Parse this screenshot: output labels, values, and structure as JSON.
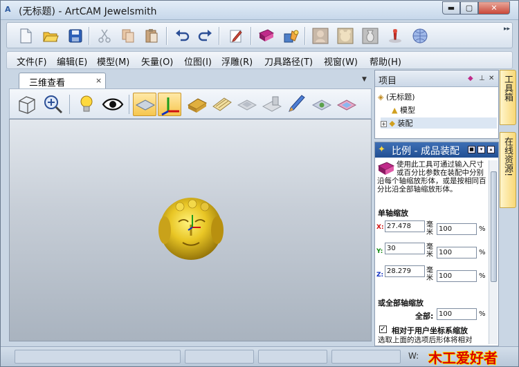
{
  "window": {
    "title": "(无标题) - ArtCAM Jewelsmith",
    "app_icon_label": "A",
    "minimize_glyph": "▬",
    "maximize_glyph": "▢",
    "close_glyph": "✕"
  },
  "toolbar": {
    "icons": [
      "new-file-icon",
      "open-folder-icon",
      "save-icon",
      "cut-icon",
      "copy-icon",
      "paste-icon",
      "undo-icon",
      "redo-icon",
      "edit-icon",
      "book-icon",
      "toolbox-icon",
      "relief-figure-icon",
      "relief-bear-icon",
      "relief-vase-icon",
      "sculpt-icon",
      "sphere-icon"
    ],
    "overflow_glyph": "▸▸"
  },
  "menu": {
    "items": [
      "文件(F)",
      "编辑(E)",
      "模型(M)",
      "矢量(O)",
      "位图(I)",
      "浮雕(R)",
      "刀具路径(T)",
      "视窗(W)",
      "帮助(H)"
    ]
  },
  "document_tab": {
    "label": "三维查看",
    "close_glyph": "×",
    "menu_glyph": "▼"
  },
  "view_toolbar": {
    "icons": [
      "cube-view-icon",
      "zoom-icon",
      "light-bulb-icon",
      "eye-icon",
      "render-plane-icon",
      "axis-icon",
      "shade-relief-icon",
      "wireframe-icon",
      "smooth-shade-icon",
      "draw-plane-icon",
      "brush-icon",
      "texture-icon",
      "color-plane-icon"
    ],
    "active": [
      "render-plane-icon",
      "axis-icon"
    ]
  },
  "project_panel": {
    "title": "项目",
    "root": "(无标题)",
    "children": [
      "模型",
      "装配"
    ],
    "expand_glyph": "+"
  },
  "tool_panel": {
    "title": "比例 - 成品装配",
    "description": "使用此工具可通过输入尺寸或百分比参数在装配中分别沿每个轴缩放形体，或是按相同百分比沿全部轴缩放形体。",
    "single_axis_label": "单轴缩放",
    "axes": [
      {
        "axis": "X:",
        "value": "27.478",
        "unit": "毫米",
        "percent": "100",
        "pct_symbol": "%",
        "color": "#d01010"
      },
      {
        "axis": "Y:",
        "value": "30",
        "unit": "毫米",
        "percent": "100",
        "pct_symbol": "%",
        "color": "#118811"
      },
      {
        "axis": "Z:",
        "value": "28.279",
        "unit": "毫米",
        "percent": "100",
        "pct_symbol": "%",
        "color": "#1030c0"
      }
    ],
    "all_axis_label": "或全部轴缩放",
    "all_label": "全部:",
    "all_percent": "100",
    "all_pct_symbol": "%",
    "checkbox_glyph": "✓",
    "checkbox_label": "相对于用户坐标系缩放",
    "trailing_text": "选取上面的选项后形体将相对"
  },
  "side_tabs": [
    "工具箱",
    "在线资源!"
  ],
  "status_bar": {
    "w_label": "W:",
    "watermark": "木工爱好者"
  }
}
